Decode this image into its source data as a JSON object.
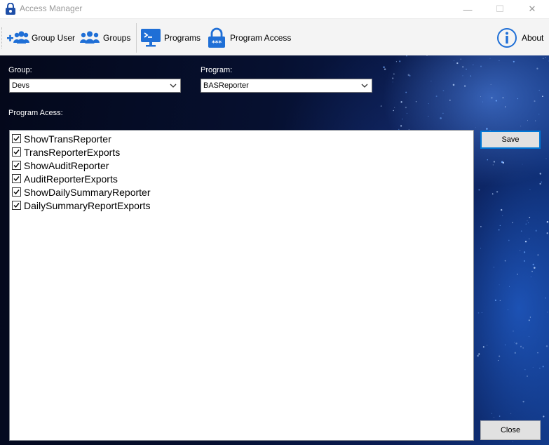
{
  "window": {
    "title": "Access Manager",
    "controls": {
      "minimize": "—",
      "maximize": "☐",
      "close": "✕"
    }
  },
  "toolbar": {
    "items": [
      {
        "label": "Group User",
        "icon": "add-user-group-icon"
      },
      {
        "label": "Groups",
        "icon": "users-group-icon"
      },
      {
        "label": "Programs",
        "icon": "terminal-monitor-icon"
      },
      {
        "label": "Program Access",
        "icon": "password-lock-icon"
      },
      {
        "label": "About",
        "icon": "info-circle-icon"
      }
    ]
  },
  "form": {
    "group_label": "Group:",
    "group_value": "Devs",
    "program_label": "Program:",
    "program_value": "BASReporter",
    "access_label": "Program Acess:",
    "access_items": [
      {
        "label": "ShowTransReporter",
        "checked": true
      },
      {
        "label": "TransReporterExports",
        "checked": true
      },
      {
        "label": "ShowAuditReporter",
        "checked": true
      },
      {
        "label": "AuditReporterExports",
        "checked": true
      },
      {
        "label": "ShowDailySummaryReporter",
        "checked": true
      },
      {
        "label": "DailySummaryReportExports",
        "checked": true
      }
    ],
    "save_label": "Save",
    "close_label": "Close"
  },
  "colors": {
    "accent": "#0078d7",
    "icon_blue": "#1f6fd6",
    "background_dark": "#061030"
  }
}
